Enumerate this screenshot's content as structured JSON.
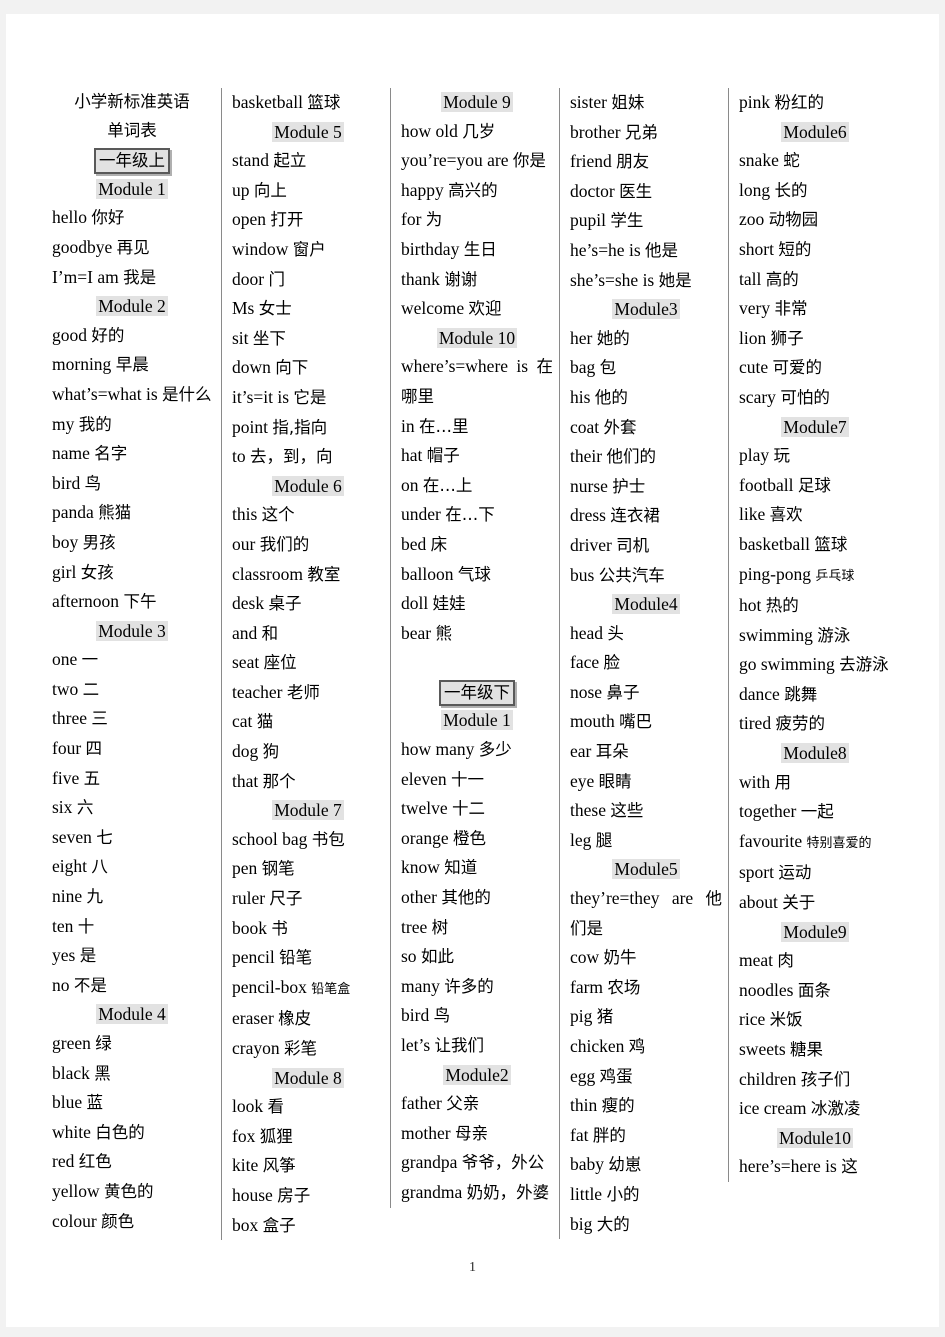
{
  "document": {
    "title_line1": "小学新标准英语",
    "title_line2": "单词表",
    "page_number": "1"
  },
  "columns": [
    {
      "id": "column-1",
      "blocks": [
        {
          "type": "title",
          "text": "小学新标准英语"
        },
        {
          "type": "title",
          "text": "单词表"
        },
        {
          "type": "grade",
          "text": "一年级上"
        },
        {
          "type": "module",
          "text": "Module 1"
        },
        {
          "type": "entry",
          "en": "hello ",
          "cn": "你好"
        },
        {
          "type": "entry",
          "en": "goodbye  ",
          "cn": "再见"
        },
        {
          "type": "entry",
          "en": "I’m=I am ",
          "cn": "我是"
        },
        {
          "type": "module",
          "text": "Module 2"
        },
        {
          "type": "entry",
          "en": "good ",
          "cn": "好的"
        },
        {
          "type": "entry",
          "en": "morning      ",
          "cn": "早晨"
        },
        {
          "type": "entry",
          "en": "what’s=what is ",
          "cn": "是什么"
        },
        {
          "type": "entry",
          "en": "my ",
          "cn": "我的"
        },
        {
          "type": "entry",
          "en": "name ",
          "cn": "名字"
        },
        {
          "type": "entry",
          "en": "bird ",
          "cn": "鸟"
        },
        {
          "type": "entry",
          "en": "panda ",
          "cn": "熊猫"
        },
        {
          "type": "entry",
          "en": "boy ",
          "cn": "男孩"
        },
        {
          "type": "entry",
          "en": "girl ",
          "cn": "女孩"
        },
        {
          "type": "entry",
          "en": "afternoon ",
          "cn": "下午"
        },
        {
          "type": "module",
          "text": "Module 3"
        },
        {
          "type": "entry",
          "en": "one   ",
          "cn": "一"
        },
        {
          "type": "entry",
          "en": "two ",
          "cn": "二"
        },
        {
          "type": "entry",
          "en": "three ",
          "cn": "三"
        },
        {
          "type": "entry",
          "en": "four   ",
          "cn": "四"
        },
        {
          "type": "entry",
          "en": "five ",
          "cn": "五"
        },
        {
          "type": "entry",
          "en": "six ",
          "cn": "六"
        },
        {
          "type": "entry",
          "en": "seven   ",
          "cn": "七"
        },
        {
          "type": "entry",
          "en": "eight ",
          "cn": "八"
        },
        {
          "type": "entry",
          "en": "nine ",
          "cn": "九"
        },
        {
          "type": "entry",
          "en": "ten   ",
          "cn": "十"
        },
        {
          "type": "entry",
          "en": "yes ",
          "cn": "是"
        },
        {
          "type": "entry",
          "en": "no ",
          "cn": "不是"
        },
        {
          "type": "module",
          "text": "Module 4"
        },
        {
          "type": "entry",
          "en": "green ",
          "cn": "绿"
        },
        {
          "type": "entry",
          "en": "black ",
          "cn": "黑"
        },
        {
          "type": "entry",
          "en": "blue ",
          "cn": "蓝"
        },
        {
          "type": "entry",
          "en": "white ",
          "cn": "白色的"
        },
        {
          "type": "entry",
          "en": "red ",
          "cn": "红色"
        },
        {
          "type": "entry",
          "en": "yellow ",
          "cn": "黄色的"
        },
        {
          "type": "entry",
          "en": "colour ",
          "cn": "颜色"
        }
      ]
    },
    {
      "id": "column-2",
      "blocks": [
        {
          "type": "entry",
          "en": "basketball ",
          "cn": "篮球"
        },
        {
          "type": "module",
          "text": "Module 5"
        },
        {
          "type": "entry",
          "en": "stand ",
          "cn": "起立"
        },
        {
          "type": "entry",
          "en": "up ",
          "cn": "向上"
        },
        {
          "type": "entry",
          "en": "open ",
          "cn": "打开"
        },
        {
          "type": "entry",
          "en": "window ",
          "cn": "窗户"
        },
        {
          "type": "entry",
          "en": "door ",
          "cn": "门"
        },
        {
          "type": "entry",
          "en": "Ms ",
          "cn": "女士"
        },
        {
          "type": "entry",
          "en": "sit ",
          "cn": "坐下"
        },
        {
          "type": "entry",
          "en": "down ",
          "cn": "向下"
        },
        {
          "type": "entry",
          "en": "it’s=it is ",
          "cn": "它是"
        },
        {
          "type": "entry",
          "en": "point ",
          "cn": "指,指向"
        },
        {
          "type": "entry",
          "en": "to ",
          "cn": "去，到，向"
        },
        {
          "type": "module",
          "text": "Module 6"
        },
        {
          "type": "entry",
          "en": "this ",
          "cn": "这个"
        },
        {
          "type": "entry",
          "en": "our ",
          "cn": "我们的"
        },
        {
          "type": "entry",
          "en": "classroom ",
          "cn": "教室"
        },
        {
          "type": "entry",
          "en": "desk ",
          "cn": "桌子"
        },
        {
          "type": "entry",
          "en": "and ",
          "cn": "和"
        },
        {
          "type": "entry",
          "en": "seat ",
          "cn": "座位"
        },
        {
          "type": "entry",
          "en": "teacher ",
          "cn": "老师"
        },
        {
          "type": "entry",
          "en": "cat ",
          "cn": "猫"
        },
        {
          "type": "entry",
          "en": "dog ",
          "cn": "狗"
        },
        {
          "type": "entry",
          "en": "that ",
          "cn": "那个"
        },
        {
          "type": "module",
          "text": "Module 7"
        },
        {
          "type": "entry",
          "en": "school bag ",
          "cn": "书包"
        },
        {
          "type": "entry",
          "en": "pen ",
          "cn": "钢笔"
        },
        {
          "type": "entry",
          "en": "ruler ",
          "cn": "尺子"
        },
        {
          "type": "entry",
          "en": "book ",
          "cn": "书"
        },
        {
          "type": "entry",
          "en": "pencil ",
          "cn": "铅笔"
        },
        {
          "type": "entry",
          "en": "pencil-box ",
          "cn": "铅笔盒",
          "small_cn": true
        },
        {
          "type": "entry",
          "en": "eraser ",
          "cn": "橡皮"
        },
        {
          "type": "entry",
          "en": "crayon ",
          "cn": "彩笔"
        },
        {
          "type": "module",
          "text": "Module 8"
        },
        {
          "type": "entry",
          "en": "look ",
          "cn": "看"
        },
        {
          "type": "entry",
          "en": "fox ",
          "cn": "狐狸"
        },
        {
          "type": "entry",
          "en": "kite ",
          "cn": "风筝"
        },
        {
          "type": "entry",
          "en": "house ",
          "cn": "房子"
        },
        {
          "type": "entry",
          "en": "box ",
          "cn": "盒子"
        }
      ]
    },
    {
      "id": "column-3",
      "blocks": [
        {
          "type": "module",
          "text": "Module 9"
        },
        {
          "type": "entry",
          "en": "how old ",
          "cn": "几岁"
        },
        {
          "type": "entry",
          "en": "you’re=you are ",
          "cn": "你是"
        },
        {
          "type": "entry",
          "en": "happy ",
          "cn": "高兴的"
        },
        {
          "type": "entry",
          "en": "for ",
          "cn": "为"
        },
        {
          "type": "entry",
          "en": "birthday ",
          "cn": "生日"
        },
        {
          "type": "entry",
          "en": "thank ",
          "cn": "谢谢"
        },
        {
          "type": "entry",
          "en": "welcome ",
          "cn": "欢迎"
        },
        {
          "type": "module",
          "text": "Module 10"
        },
        {
          "type": "entry",
          "en": "where’s=where is ",
          "cn": "在哪里"
        },
        {
          "type": "entry",
          "en": "in ",
          "cn": "在…里"
        },
        {
          "type": "entry",
          "en": "hat ",
          "cn": "帽子"
        },
        {
          "type": "entry",
          "en": "on ",
          "cn": "在…上"
        },
        {
          "type": "entry",
          "en": "under ",
          "cn": "在…下"
        },
        {
          "type": "entry",
          "en": "bed ",
          "cn": "床"
        },
        {
          "type": "entry",
          "en": "balloon ",
          "cn": "气球"
        },
        {
          "type": "entry",
          "en": "doll ",
          "cn": "娃娃"
        },
        {
          "type": "entry",
          "en": "bear   ",
          "cn": "熊"
        },
        {
          "type": "spacer"
        },
        {
          "type": "grade",
          "text": "一年级下"
        },
        {
          "type": "module",
          "text": "Module 1"
        },
        {
          "type": "entry",
          "en": "how many ",
          "cn": "多少"
        },
        {
          "type": "entry",
          "en": "eleven ",
          "cn": "十一"
        },
        {
          "type": "entry",
          "en": "twelve ",
          "cn": "十二"
        },
        {
          "type": "entry",
          "en": "orange ",
          "cn": "橙色"
        },
        {
          "type": "entry",
          "en": "know ",
          "cn": "知道"
        },
        {
          "type": "entry",
          "en": "other ",
          "cn": "其他的"
        },
        {
          "type": "entry",
          "en": "tree ",
          "cn": "树"
        },
        {
          "type": "entry",
          "en": "so ",
          "cn": "如此"
        },
        {
          "type": "entry",
          "en": "many ",
          "cn": "许多的"
        },
        {
          "type": "entry",
          "en": "bird ",
          "cn": "鸟"
        },
        {
          "type": "entry",
          "en": "let’s ",
          "cn": "让我们"
        },
        {
          "type": "module",
          "text": "Module2"
        },
        {
          "type": "entry",
          "en": "father ",
          "cn": "父亲"
        },
        {
          "type": "entry",
          "en": "mother ",
          "cn": "母亲"
        },
        {
          "type": "entry",
          "en": "grandpa ",
          "cn": "爷爷，外公"
        },
        {
          "type": "entry",
          "en": "grandma ",
          "cn": "奶奶，外婆"
        }
      ]
    },
    {
      "id": "column-4",
      "blocks": [
        {
          "type": "entry",
          "en": "sister ",
          "cn": "姐妹"
        },
        {
          "type": "entry",
          "en": "brother ",
          "cn": "兄弟"
        },
        {
          "type": "entry",
          "en": "friend ",
          "cn": "朋友"
        },
        {
          "type": "entry",
          "en": "doctor ",
          "cn": "医生"
        },
        {
          "type": "entry",
          "en": "pupil ",
          "cn": "学生"
        },
        {
          "type": "entry",
          "en": "he’s=he is ",
          "cn": "他是"
        },
        {
          "type": "entry",
          "en": "she’s=she is ",
          "cn": "她是"
        },
        {
          "type": "module",
          "text": "Module3"
        },
        {
          "type": "entry",
          "en": "her ",
          "cn": "她的"
        },
        {
          "type": "entry",
          "en": "bag ",
          "cn": "包"
        },
        {
          "type": "entry",
          "en": "his ",
          "cn": "他的"
        },
        {
          "type": "entry",
          "en": "coat ",
          "cn": "外套"
        },
        {
          "type": "entry",
          "en": "their ",
          "cn": "他们的"
        },
        {
          "type": "entry",
          "en": "nurse ",
          "cn": "护士"
        },
        {
          "type": "entry",
          "en": "dress ",
          "cn": "连衣裙"
        },
        {
          "type": "entry",
          "en": "driver ",
          "cn": "司机"
        },
        {
          "type": "entry",
          "en": "bus ",
          "cn": "公共汽车"
        },
        {
          "type": "module",
          "text": "Module4"
        },
        {
          "type": "entry",
          "en": "head ",
          "cn": "头"
        },
        {
          "type": "entry",
          "en": "face ",
          "cn": "脸"
        },
        {
          "type": "entry",
          "en": "nose ",
          "cn": "鼻子"
        },
        {
          "type": "entry",
          "en": "mouth ",
          "cn": "嘴巴"
        },
        {
          "type": "entry",
          "en": "ear ",
          "cn": "耳朵"
        },
        {
          "type": "entry",
          "en": "eye ",
          "cn": "眼睛"
        },
        {
          "type": "entry",
          "en": "these ",
          "cn": "这些"
        },
        {
          "type": "entry",
          "en": "leg ",
          "cn": "腿"
        },
        {
          "type": "module",
          "text": "Module5"
        },
        {
          "type": "entry",
          "en": "they’re=they are ",
          "cn": "他们是"
        },
        {
          "type": "entry",
          "en": "cow ",
          "cn": "奶牛"
        },
        {
          "type": "entry",
          "en": "farm ",
          "cn": "农场"
        },
        {
          "type": "entry",
          "en": "pig ",
          "cn": "猪"
        },
        {
          "type": "entry",
          "en": "chicken   ",
          "cn": "鸡"
        },
        {
          "type": "entry",
          "en": "egg ",
          "cn": "鸡蛋"
        },
        {
          "type": "entry",
          "en": "thin ",
          "cn": "瘦的"
        },
        {
          "type": "entry",
          "en": "fat ",
          "cn": "胖的"
        },
        {
          "type": "entry",
          "en": "baby ",
          "cn": "幼崽"
        },
        {
          "type": "entry",
          "en": "little ",
          "cn": "小的"
        },
        {
          "type": "entry",
          "en": "big ",
          "cn": "大的"
        }
      ]
    },
    {
      "id": "column-5",
      "blocks": [
        {
          "type": "entry",
          "en": "pink ",
          "cn": "粉红的"
        },
        {
          "type": "module",
          "text": "Module6"
        },
        {
          "type": "entry",
          "en": "snake ",
          "cn": "蛇"
        },
        {
          "type": "entry",
          "en": "long ",
          "cn": "长的"
        },
        {
          "type": "entry",
          "en": "zoo ",
          "cn": "动物园"
        },
        {
          "type": "entry",
          "en": "short ",
          "cn": "短的"
        },
        {
          "type": "entry",
          "en": "tall ",
          "cn": "高的"
        },
        {
          "type": "entry",
          "en": "very ",
          "cn": "非常"
        },
        {
          "type": "entry",
          "en": "lion ",
          "cn": "狮子"
        },
        {
          "type": "entry",
          "en": "cute ",
          "cn": "可爱的"
        },
        {
          "type": "entry",
          "en": "scary ",
          "cn": "可怕的"
        },
        {
          "type": "module",
          "text": "Module7"
        },
        {
          "type": "entry",
          "en": "play ",
          "cn": "玩"
        },
        {
          "type": "entry",
          "en": "football ",
          "cn": "足球"
        },
        {
          "type": "entry",
          "en": "like ",
          "cn": "喜欢"
        },
        {
          "type": "entry",
          "en": "basketball ",
          "cn": "篮球"
        },
        {
          "type": "entry",
          "en": "ping-pong ",
          "cn": "乒乓球",
          "small_cn": true
        },
        {
          "type": "entry",
          "en": "hot ",
          "cn": "热的"
        },
        {
          "type": "entry",
          "en": "swimming ",
          "cn": "游泳"
        },
        {
          "type": "entry",
          "en": "go swimming ",
          "cn": "去游泳"
        },
        {
          "type": "entry",
          "en": "dance ",
          "cn": "跳舞"
        },
        {
          "type": "entry",
          "en": "tired ",
          "cn": "疲劳的"
        },
        {
          "type": "module",
          "text": "Module8"
        },
        {
          "type": "entry",
          "en": "with ",
          "cn": "用"
        },
        {
          "type": "entry",
          "en": "together ",
          "cn": "一起"
        },
        {
          "type": "entry",
          "en": "favourite ",
          "cn": "特别喜爱的",
          "small_cn": true
        },
        {
          "type": "entry",
          "en": "sport ",
          "cn": "运动"
        },
        {
          "type": "entry",
          "en": "about ",
          "cn": "关于"
        },
        {
          "type": "module",
          "text": "Module9"
        },
        {
          "type": "entry",
          "en": "meat ",
          "cn": "肉"
        },
        {
          "type": "entry",
          "en": "noodles ",
          "cn": "面条"
        },
        {
          "type": "entry",
          "en": "rice ",
          "cn": "米饭"
        },
        {
          "type": "entry",
          "en": "sweets ",
          "cn": "糖果"
        },
        {
          "type": "entry",
          "en": "children ",
          "cn": "孩子们"
        },
        {
          "type": "entry",
          "en": "ice cream ",
          "cn": "冰激凌"
        },
        {
          "type": "module",
          "text": "Module10"
        },
        {
          "type": "entry",
          "en": "here’s=here is ",
          "cn": "这"
        }
      ]
    }
  ]
}
